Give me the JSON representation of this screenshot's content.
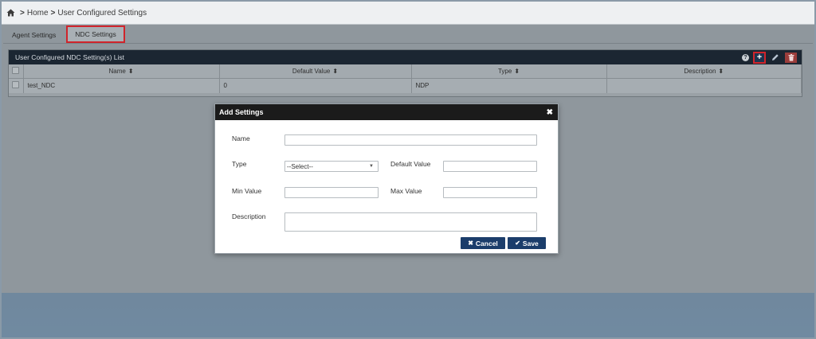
{
  "breadcrumb": {
    "home": "Home",
    "current": "User Configured Settings"
  },
  "tabs": [
    {
      "label": "Agent Settings",
      "active": false
    },
    {
      "label": "NDC Settings",
      "active": true
    }
  ],
  "panel": {
    "title": "User Configured NDC Setting(s) List",
    "tools": {
      "help": "?",
      "add": "+"
    },
    "columns": [
      "Name",
      "Default Value",
      "Type",
      "Description"
    ],
    "rows": [
      {
        "name": "test_NDC",
        "default_value": "0",
        "type": "NDP",
        "description": ""
      }
    ]
  },
  "modal": {
    "title": "Add Settings",
    "close": "✖",
    "labels": {
      "name": "Name",
      "type": "Type",
      "default_value": "Default Value",
      "min_value": "Min Value",
      "max_value": "Max Value",
      "description": "Description"
    },
    "type_selected": "--Select--",
    "buttons": {
      "cancel": "Cancel",
      "save": "Save"
    }
  },
  "colors": {
    "header_dark": "#1b2632",
    "accent_red": "#d0242b",
    "button_blue": "#1b3d6b"
  }
}
